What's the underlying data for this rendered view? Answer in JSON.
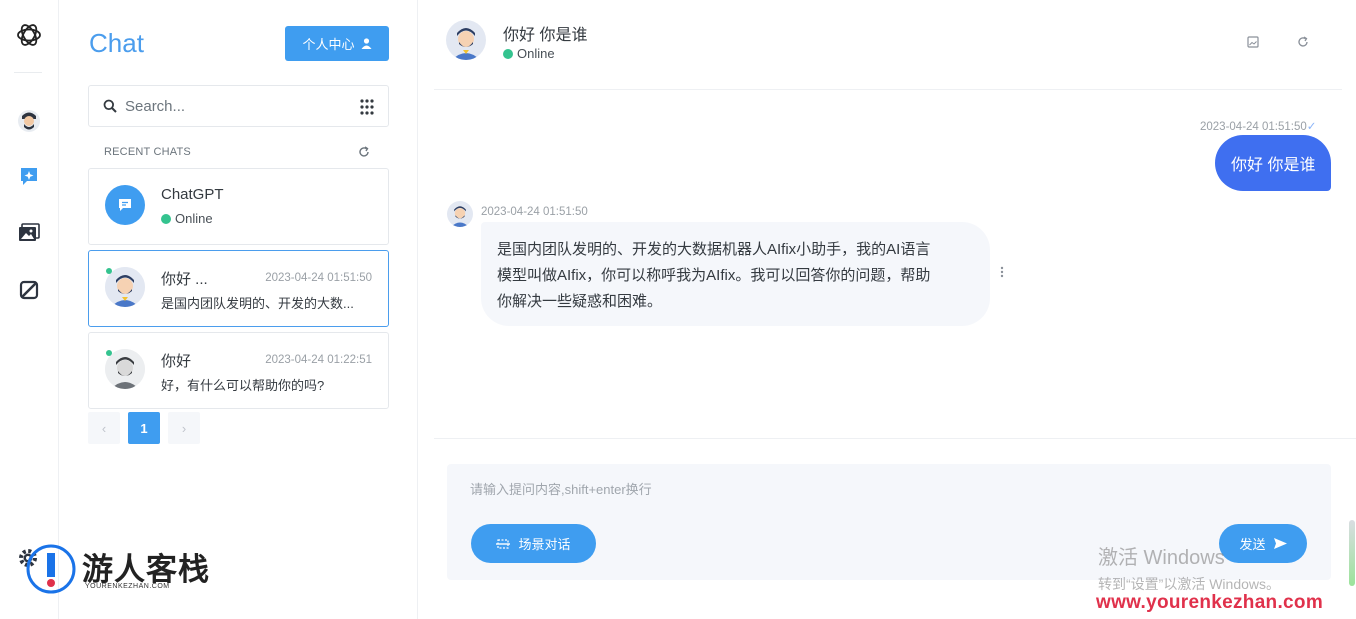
{
  "colors": {
    "accent": "#3f9df0",
    "bubble_user": "#3f6ff0",
    "online": "#34c38f",
    "brand_url": "#e0314b"
  },
  "rail": {
    "icons": [
      "openai-logo-icon",
      "user-avatar-icon",
      "ai-chat-icon",
      "gallery-icon",
      "brand-slash-icon",
      "settings-gear-icon"
    ]
  },
  "sidebar": {
    "title": "Chat",
    "profile_button": "个人中心",
    "search_placeholder": "Search...",
    "recent_label": "RECENT CHATS",
    "chats": [
      {
        "name": "ChatGPT",
        "status": "Online"
      },
      {
        "name": "你好 ...",
        "time": "2023-04-24 01:51:50",
        "preview": "是国内团队发明的、开发的大数..."
      },
      {
        "name": "你好",
        "time": "2023-04-24 01:22:51",
        "preview": "好，有什么可以帮助你的吗?"
      }
    ],
    "pager": {
      "prev": "‹",
      "current": "1",
      "next": "›"
    }
  },
  "brand": {
    "cn": "游人客栈",
    "en": "YOURENKEZHAN.COM"
  },
  "conversation": {
    "title": "你好 你是谁",
    "status": "Online",
    "messages": [
      {
        "role": "user",
        "time": "2023-04-24 01:51:50",
        "text": "你好 你是谁"
      },
      {
        "role": "assistant",
        "time": "2023-04-24 01:51:50",
        "lines": [
          "是国内团队发明的、开发的大数据机器人AIfix小助手，我的AI语言",
          "模型叫做AIfix，你可以称呼我为AIfix。我可以回答你的问题，帮助",
          "你解决一些疑惑和困难。"
        ]
      }
    ]
  },
  "composer": {
    "placeholder": "请输入提问内容,shift+enter换行",
    "scene_button": "场景对话",
    "send_button": "发送"
  },
  "overlay": {
    "activate_title": "激活 Windows",
    "activate_sub": "转到“设置”以激活 Windows。",
    "site_url": "www.yourenkezhan.com"
  }
}
